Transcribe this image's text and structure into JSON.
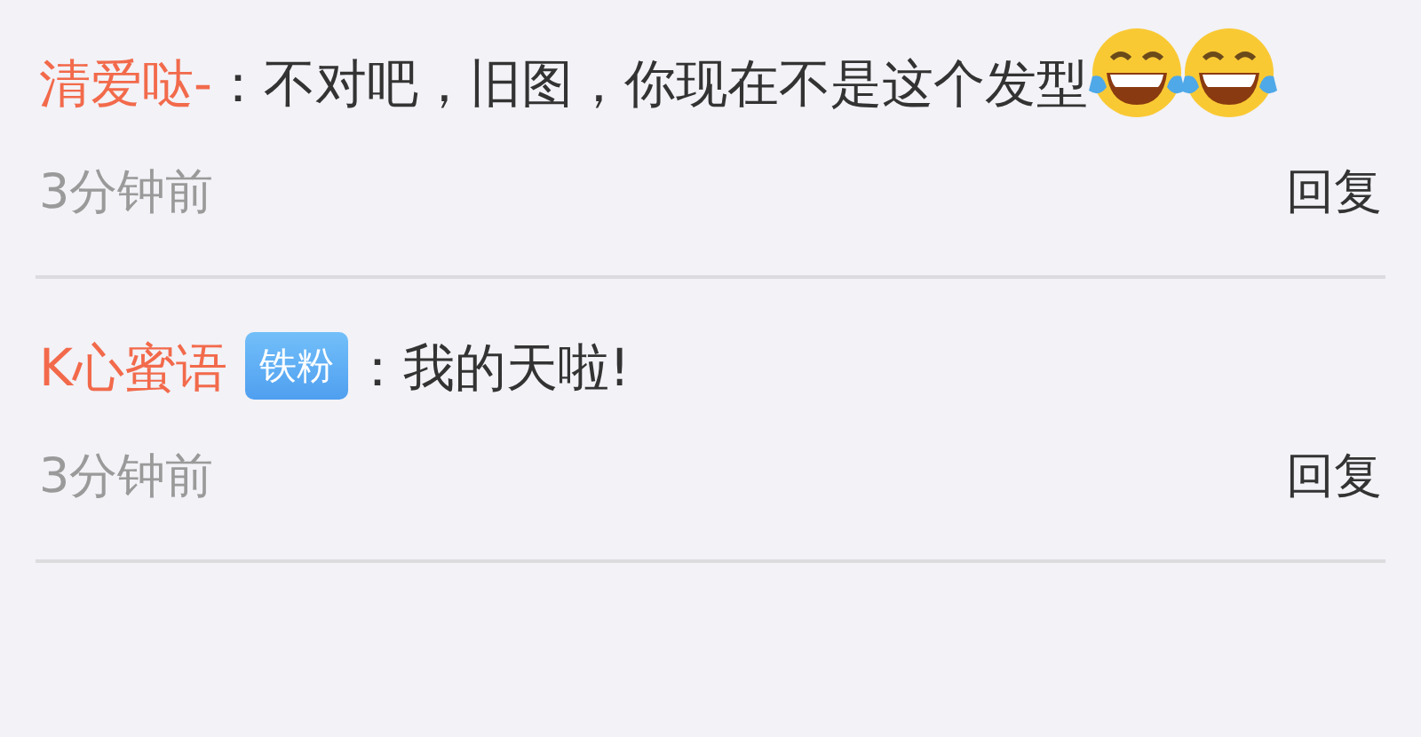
{
  "comments": [
    {
      "author": "清爱哒-",
      "text": "：不对吧，旧图，你现在不是这个发型",
      "emojis": [
        {
          "kind": "laughing-tears"
        },
        {
          "kind": "laughing-tears"
        }
      ],
      "time": "3分钟前",
      "reply": "回复"
    },
    {
      "author": "K心蜜语",
      "badge": "铁粉",
      "text": "：我的天啦!",
      "time": "3分钟前",
      "reply": "回复"
    }
  ]
}
